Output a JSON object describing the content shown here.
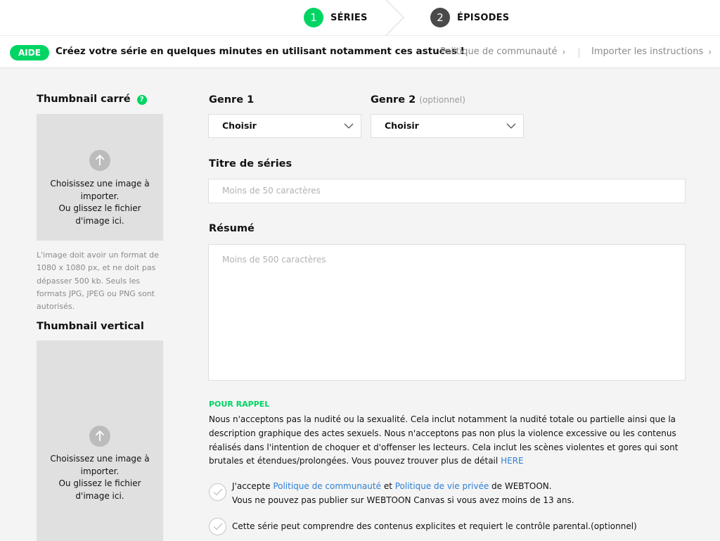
{
  "stepper": {
    "steps": [
      {
        "number": "1",
        "label": "SÉRIES"
      },
      {
        "number": "2",
        "label": "ÉPISODES"
      }
    ]
  },
  "helpbar": {
    "badge": "AIDE",
    "text": "Créez votre série en quelques minutes en utilisant notamment ces astuces !",
    "links": [
      {
        "label": "Politique de communauté",
        "icon": "chevron-right-icon"
      },
      {
        "label": "Importer les instructions",
        "icon": "chevron-right-icon"
      }
    ]
  },
  "thumbnail_square": {
    "title": "Thumbnail carré",
    "help_icon": "?",
    "upload_line1": "Choisissez une image à importer.",
    "upload_line2": "Ou glissez le fichier d'image ici.",
    "note": "L'image doit avoir un format de 1080 x 1080 px, et ne doit pas dépasser 500 kb. Seuls les formats JPG, JPEG ou PNG sont autorisés."
  },
  "thumbnail_vertical": {
    "title": "Thumbnail vertical",
    "upload_line1": "Choisissez une image à importer.",
    "upload_line2": "Ou glissez le fichier d'image ici."
  },
  "form": {
    "genre1": {
      "label": "Genre 1",
      "value": "Choisir"
    },
    "genre2": {
      "label": "Genre 2",
      "optional": "(optionnel)",
      "value": "Choisir"
    },
    "title": {
      "label": "Titre de séries",
      "placeholder": "Moins de 50 caractères"
    },
    "resume": {
      "label": "Résumé",
      "placeholder": "Moins de 500 caractères"
    }
  },
  "rappel": {
    "title": "POUR RAPPEL",
    "text": "Nous n'acceptons pas la nudité ou la sexualité. Cela inclut notamment la nudité totale ou partielle ainsi que la description graphique des actes sexuels. Nous n'acceptons pas non plus la violence excessive ou les contenus réalisés dans l'intention de choquer et d'offenser les lecteurs. Cela inclut les scènes violentes et gores qui sont brutales et étendues/prolongées. Vous pouvez trouver plus de détail",
    "link": "HERE"
  },
  "agreements": {
    "accept_prefix": "J'accepte",
    "policy_link": "Politique de communauté",
    "and": "et",
    "privacy_link": "Politique de vie privée",
    "accept_suffix": "de WEBTOON.",
    "age_notice": "Vous ne pouvez pas publier sur WEBTOON Canvas si vous avez moins de 13 ans.",
    "explicit": "Cette série peut comprendre des contenus explicites et requiert le contrôle parental.(optionnel)"
  },
  "colors": {
    "accent": "#00d564",
    "link": "#2e7fd6",
    "muted": "#8a8a8a"
  }
}
